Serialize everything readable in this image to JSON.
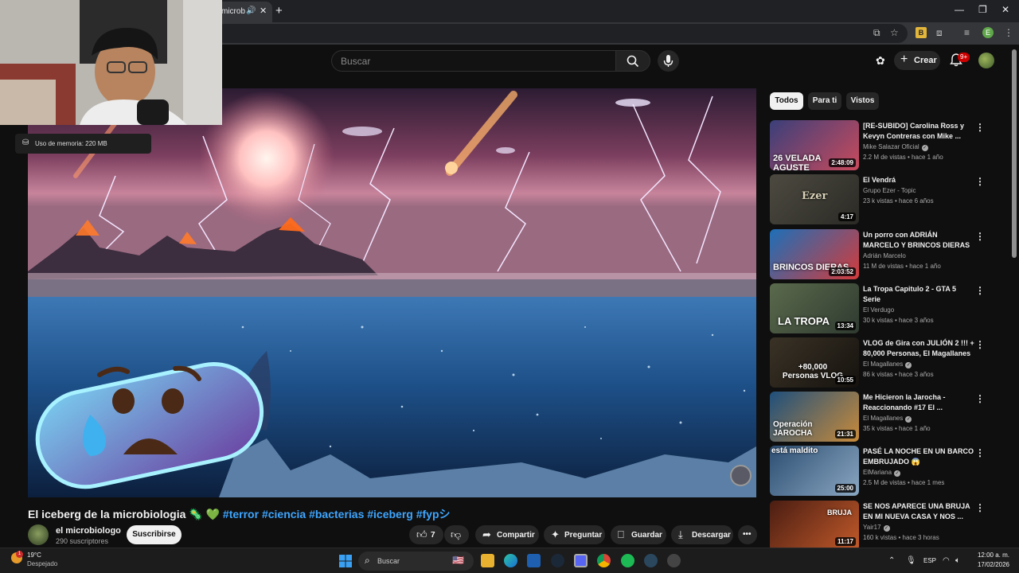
{
  "browser": {
    "tab_title": "microb",
    "tab_close": "✕",
    "new_tab": "+",
    "profile_initial": "E",
    "ext_label": "B"
  },
  "header": {
    "search_placeholder": "Buscar",
    "create_label": "Crear",
    "notif_badge": "9+"
  },
  "overlay": {
    "memory_label": "Uso de memoria: 220 MB"
  },
  "video": {
    "title": "El iceberg de la microbiologia 🦠 💚 ",
    "hashtags": "#terror #ciencia #bacterias #iceberg #fypシ",
    "channel_name": "el microbiologo",
    "subscribers": "290 suscriptores",
    "subscribe_label": "Suscribirse",
    "likes": "7",
    "share_label": "Compartir",
    "ask_label": "Preguntar",
    "save_label": "Guardar",
    "download_label": "Descargar",
    "more_label": "•••"
  },
  "sidebar": {
    "chips": [
      "Todos",
      "Para ti",
      "Vistos"
    ],
    "recs": [
      {
        "title": "[RE-SUBIDO] Carolina Ross y Kevyn Contreras con Mike ...",
        "channel": "Mike Salazar Oficial",
        "verified": true,
        "meta": "2.2 M de vistas • hace 1 año",
        "duration": "2:48:09",
        "thumb_text": "26 VELADA AGUSTE"
      },
      {
        "title": "El Vendrá",
        "channel": "Grupo Ezer - Topic",
        "verified": false,
        "meta": "23 k vistas • hace 6 años",
        "duration": "4:17",
        "thumb_text": "Ezer"
      },
      {
        "title": "Un porro con ADRIÁN MARCELO Y BRINCOS DIERAS",
        "channel": "Adrián Marcelo",
        "verified": false,
        "meta": "11 M de vistas • hace 1 año",
        "duration": "2:03:52",
        "thumb_text": "BRINCOS DIERAS"
      },
      {
        "title": "La Tropa Capitulo 2 - GTA 5 Serie",
        "channel": "El Verdugo",
        "verified": false,
        "meta": "30 k vistas • hace 3 años",
        "duration": "13:34",
        "thumb_text": "LA TROPA"
      },
      {
        "title": "VLOG de Gira con JULIÓN 2 !!! + 80,000 Personas, El Magallanes",
        "channel": "El Magallanes",
        "verified": true,
        "meta": "86 k vistas • hace 3 años",
        "duration": "10:55",
        "thumb_text": "+80,000 Personas VLOG"
      },
      {
        "title": "Me Hicieron la Jarocha - Reaccionando #17 El ...",
        "channel": "El Magallanes",
        "verified": true,
        "meta": "35 k vistas • hace 1 año",
        "duration": "21:31",
        "thumb_text": "Operación JAROCHA"
      },
      {
        "title": "PASÉ LA NOCHE EN UN BARCO EMBRUJADO 😱",
        "channel": "ElMariana",
        "verified": true,
        "meta": "2.5 M de vistas • hace 1 mes",
        "duration": "25:00",
        "thumb_text": "está maldito"
      },
      {
        "title": "SE NOS APARECE UNA BRUJA EN MI NUEVA CASA Y NOS ...",
        "channel": "Yair17",
        "verified": true,
        "meta": "160 k vistas • hace 3 horas",
        "duration": "11:17",
        "thumb_text": "BRUJA"
      }
    ]
  },
  "taskbar": {
    "temp": "19°C",
    "weather": "Despejado",
    "weather_badge": "1",
    "search_label": "Buscar",
    "lang": "ESP",
    "time": "12:00 a. m.",
    "date": "17/02/2026"
  },
  "colors": {
    "background": "#0f0f0f",
    "link": "#3ea6ff",
    "chip_active": "#f1f1f1"
  }
}
